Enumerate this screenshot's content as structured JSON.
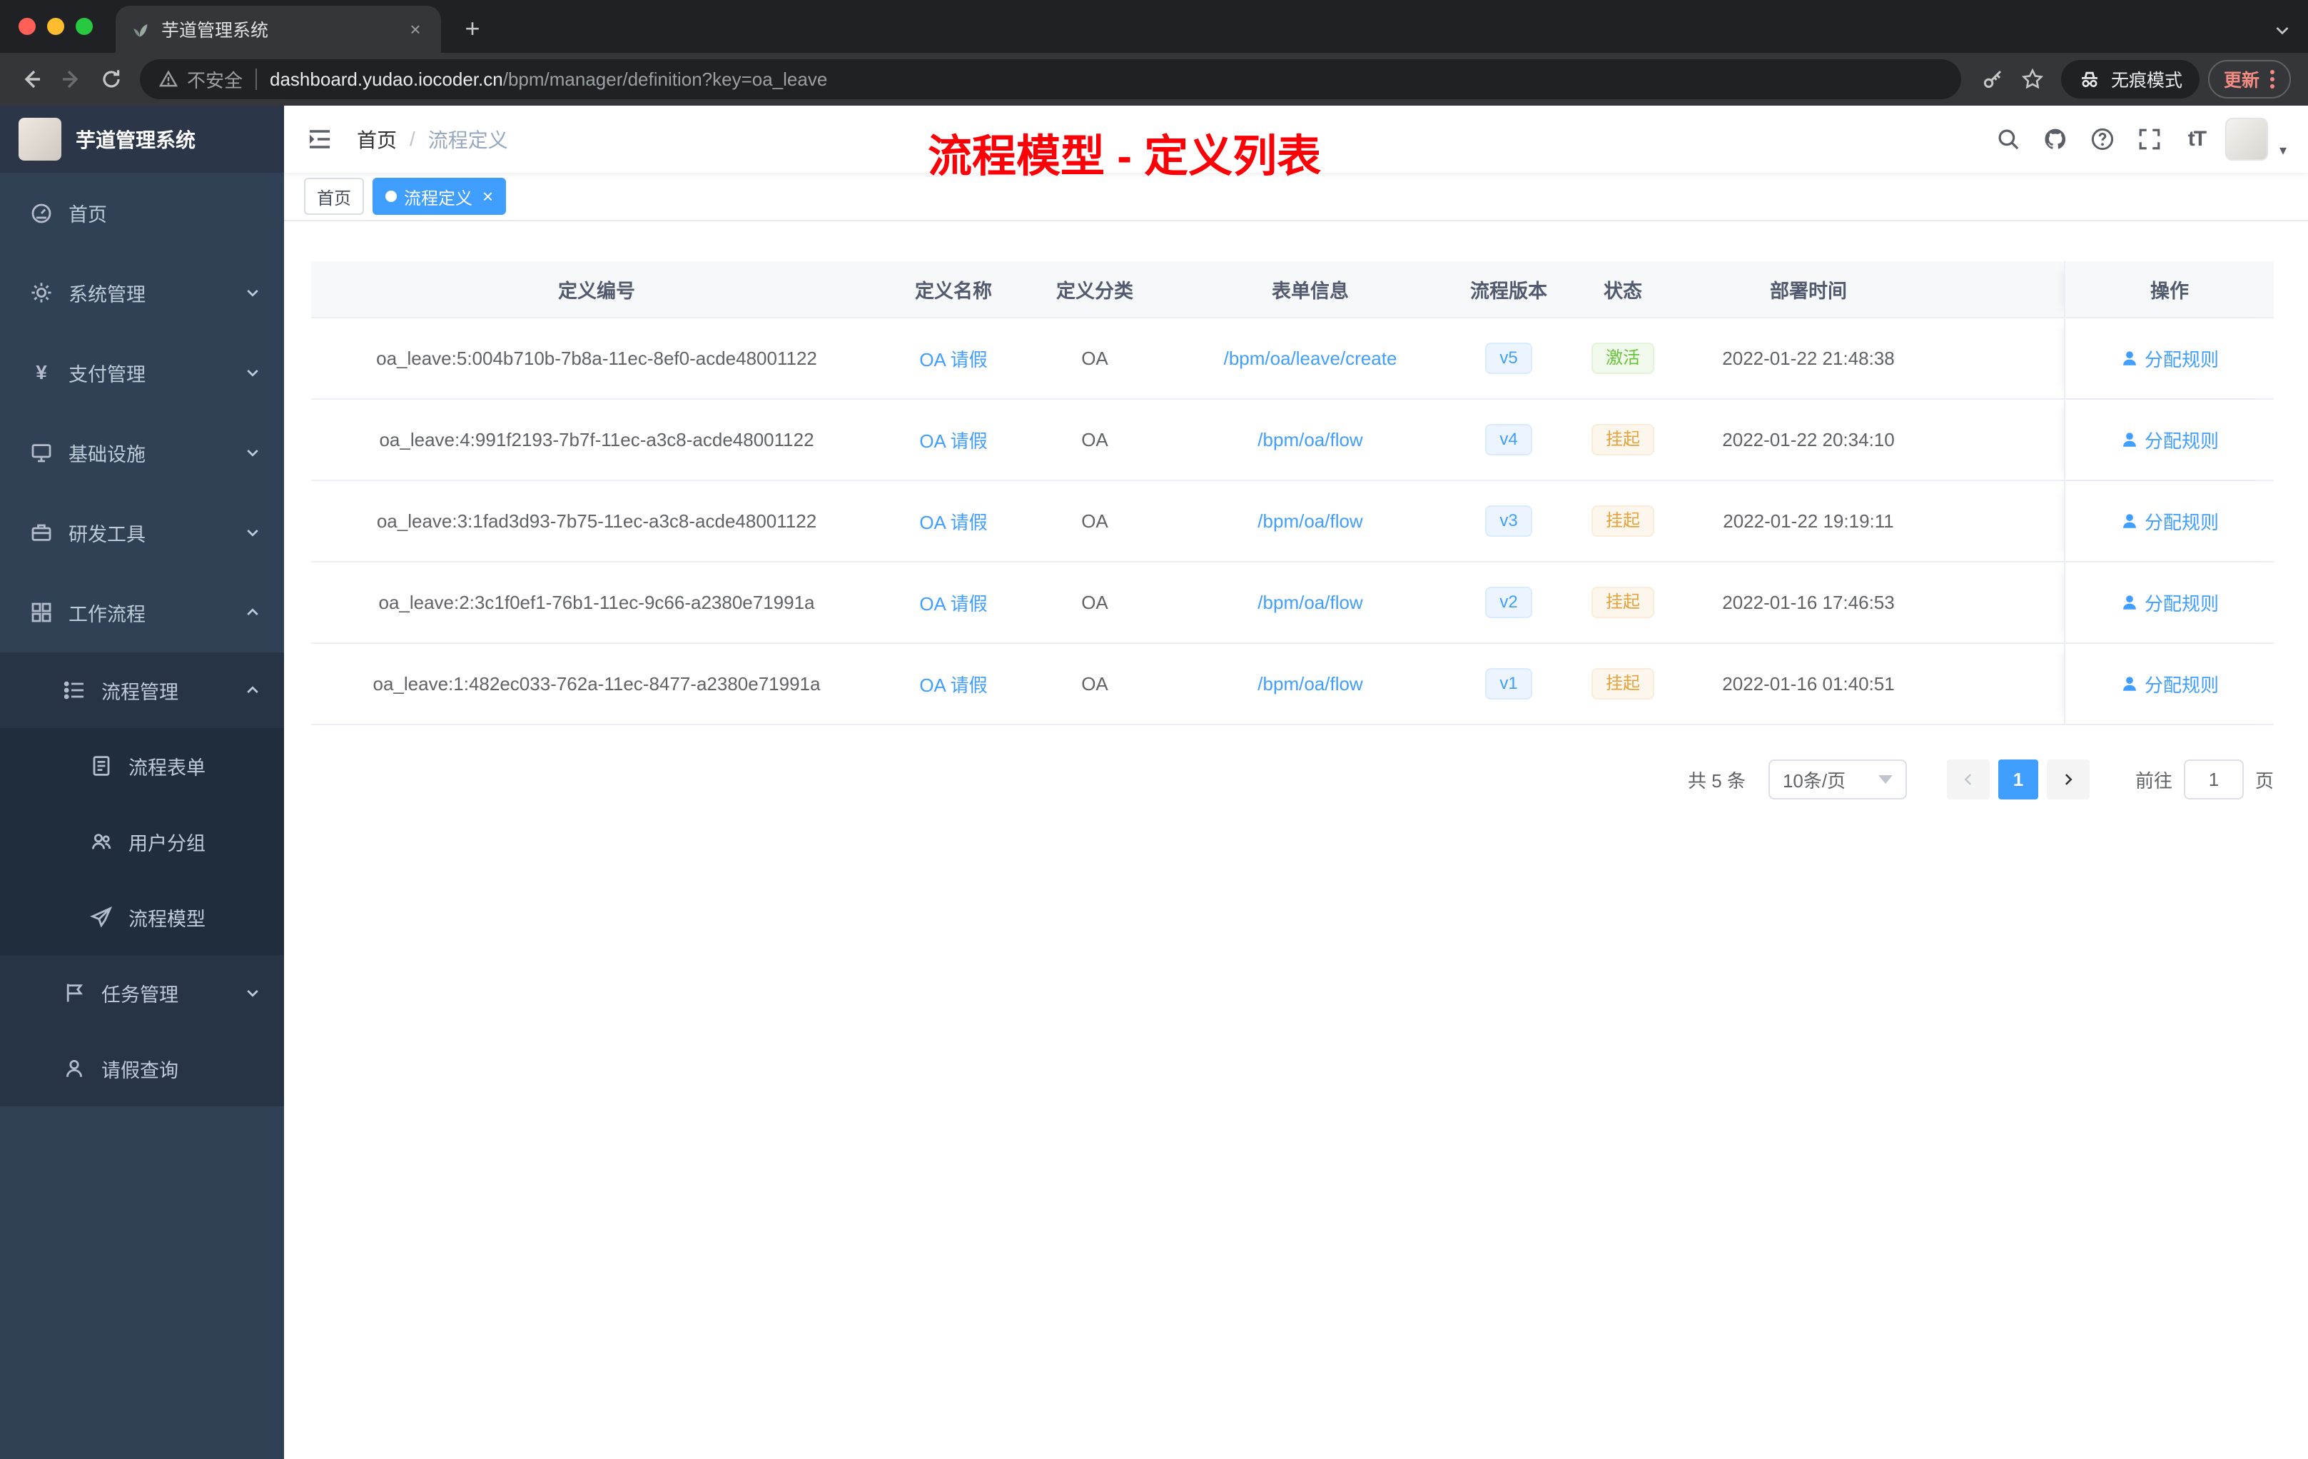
{
  "colors": {
    "accent": "#409eff",
    "annotation_red": "#fb0006",
    "success": "#67c23a",
    "warning": "#e6a23c",
    "sidebar_bg": "#304156"
  },
  "browser": {
    "tab_title": "芋道管理系统",
    "security_label": "不安全",
    "url_domain": "dashboard.yudao.iocoder.cn",
    "url_path": "/bpm/manager/definition?key=oa_leave",
    "incognito_label": "无痕模式",
    "update_label": "更新"
  },
  "app": {
    "brand": "芋道管理系统",
    "breadcrumb": {
      "home": "首页",
      "current": "流程定义"
    },
    "annotation": "流程模型 - 定义列表",
    "font_size_icon_label": "tT",
    "tags": [
      {
        "label": "首页",
        "active": false,
        "closable": false
      },
      {
        "label": "流程定义",
        "active": true,
        "closable": true
      }
    ]
  },
  "sidebar": {
    "items": [
      {
        "label": "首页",
        "icon": "dashboard-icon",
        "level": 0
      },
      {
        "label": "系统管理",
        "icon": "gear-icon",
        "level": 0,
        "chevron": "down"
      },
      {
        "label": "支付管理",
        "icon": "payment-icon",
        "level": 0,
        "chevron": "down"
      },
      {
        "label": "基础设施",
        "icon": "infrastructure-icon",
        "level": 0,
        "chevron": "down"
      },
      {
        "label": "研发工具",
        "icon": "dev-tools-icon",
        "level": 0,
        "chevron": "down"
      },
      {
        "label": "工作流程",
        "icon": "workflow-icon",
        "level": 0,
        "chevron": "up"
      },
      {
        "label": "流程管理",
        "icon": "process-manage-icon",
        "level": 1,
        "chevron": "up"
      },
      {
        "label": "流程表单",
        "icon": "form-icon",
        "level": 2
      },
      {
        "label": "用户分组",
        "icon": "user-group-icon",
        "level": 2
      },
      {
        "label": "流程模型",
        "icon": "process-model-icon",
        "level": 2
      },
      {
        "label": "任务管理",
        "icon": "task-icon",
        "level": 1,
        "chevron": "down"
      },
      {
        "label": "请假查询",
        "icon": "leave-query-icon",
        "level": 1
      }
    ]
  },
  "table": {
    "columns": [
      "定义编号",
      "定义名称",
      "定义分类",
      "表单信息",
      "流程版本",
      "状态",
      "部署时间",
      "操作"
    ],
    "rows": [
      {
        "id": "oa_leave:5:004b710b-7b8a-11ec-8ef0-acde48001122",
        "name": "OA 请假",
        "category": "OA",
        "form": "/bpm/oa/leave/create",
        "version": "v5",
        "status": "激活",
        "status_type": "success",
        "time": "2022-01-22 21:48:38",
        "action": "分配规则"
      },
      {
        "id": "oa_leave:4:991f2193-7b7f-11ec-a3c8-acde48001122",
        "name": "OA 请假",
        "category": "OA",
        "form": "/bpm/oa/flow",
        "version": "v4",
        "status": "挂起",
        "status_type": "warning",
        "time": "2022-01-22 20:34:10",
        "action": "分配规则"
      },
      {
        "id": "oa_leave:3:1fad3d93-7b75-11ec-a3c8-acde48001122",
        "name": "OA 请假",
        "category": "OA",
        "form": "/bpm/oa/flow",
        "version": "v3",
        "status": "挂起",
        "status_type": "warning",
        "time": "2022-01-22 19:19:11",
        "action": "分配规则"
      },
      {
        "id": "oa_leave:2:3c1f0ef1-76b1-11ec-9c66-a2380e71991a",
        "name": "OA 请假",
        "category": "OA",
        "form": "/bpm/oa/flow",
        "version": "v2",
        "status": "挂起",
        "status_type": "warning",
        "time": "2022-01-16 17:46:53",
        "action": "分配规则"
      },
      {
        "id": "oa_leave:1:482ec033-762a-11ec-8477-a2380e71991a",
        "name": "OA 请假",
        "category": "OA",
        "form": "/bpm/oa/flow",
        "version": "v1",
        "status": "挂起",
        "status_type": "warning",
        "time": "2022-01-16 01:40:51",
        "action": "分配规则"
      }
    ]
  },
  "pagination": {
    "total_label": "共 5 条",
    "page_size_label": "10条/页",
    "current_page": "1",
    "goto_prefix": "前往",
    "goto_value": "1",
    "goto_suffix": "页"
  }
}
